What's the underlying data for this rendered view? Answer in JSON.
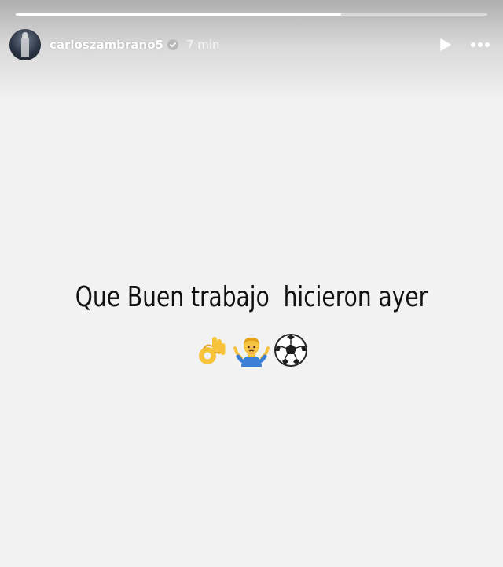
{
  "story": {
    "progress_fraction": 0.69,
    "author": {
      "username": "carloszambrano5",
      "verified": true,
      "avatar_icon": "profile-photo"
    },
    "time_ago": "7 min",
    "controls": {
      "play_icon": "play-icon",
      "more_icon": "more-options-icon"
    },
    "caption": "Que Buen trabajo  hicieron ayer",
    "emojis": [
      "ok-hand-emoji",
      "shrugging-man-emoji",
      "soccer-ball-emoji"
    ],
    "background_color": "#f2f2f2"
  }
}
